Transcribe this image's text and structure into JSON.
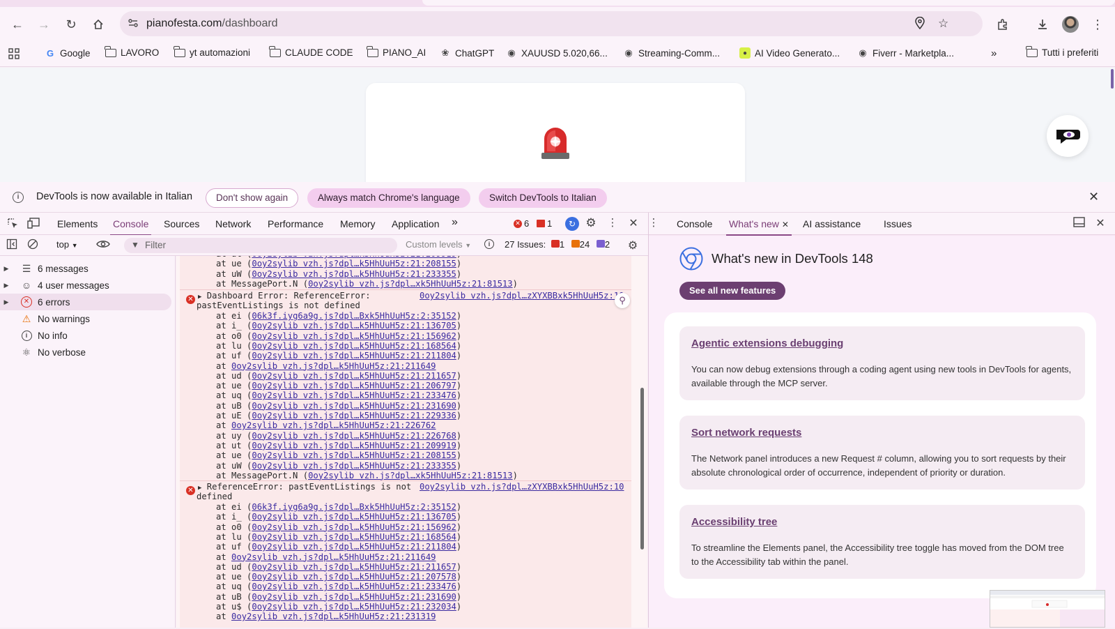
{
  "browser": {
    "url_host": "pianofesta.com",
    "url_path": "/dashboard",
    "icons": [
      "back-icon",
      "forward-icon",
      "reload-icon",
      "home-icon",
      "site-info-icon",
      "location-icon",
      "bookmark-star-icon",
      "extensions-icon",
      "download-icon",
      "profile-avatar",
      "menu-kebab-icon"
    ]
  },
  "bookmarks": [
    {
      "label": "Google",
      "icon": "google-icon"
    },
    {
      "label": "LAVORO",
      "icon": "folder-icon"
    },
    {
      "label": "yt automazioni",
      "icon": "folder-icon"
    },
    {
      "label": "CLAUDE CODE",
      "icon": "folder-icon"
    },
    {
      "label": "PIANO_AI",
      "icon": "folder-icon"
    },
    {
      "label": "ChatGPT",
      "icon": "chatgpt-icon"
    },
    {
      "label": "XAUUSD 5.020,66...",
      "icon": "globe-icon"
    },
    {
      "label": "Streaming-Comm...",
      "icon": "globe-icon"
    },
    {
      "label": "AI Video Generato...",
      "icon": "ai-video-icon"
    },
    {
      "label": "Fiverr - Marketpla...",
      "icon": "globe-icon"
    }
  ],
  "bookmarks_all": "Tutti i preferiti",
  "infobar": {
    "message": "DevTools is now available in Italian",
    "dont_show": "Don't show again",
    "always_match": "Always match Chrome's language",
    "switch": "Switch DevTools to Italian"
  },
  "devtools": {
    "tabs": [
      "Elements",
      "Console",
      "Sources",
      "Network",
      "Performance",
      "Memory",
      "Application"
    ],
    "active_tab": "Console",
    "error_count": "6",
    "warning_count": "1",
    "context": "top",
    "filter_placeholder": "Filter",
    "levels": "Custom levels",
    "issues_label": "27 Issues:",
    "issues_errors": "1",
    "issues_warnings": "24",
    "issues_info": "2"
  },
  "sidebar": [
    {
      "label": "6 messages",
      "icon": "list-icon",
      "expandable": true
    },
    {
      "label": "4 user messages",
      "icon": "user-icon",
      "expandable": true
    },
    {
      "label": "6 errors",
      "icon": "error-icon",
      "expandable": true,
      "selected": true
    },
    {
      "label": "No warnings",
      "icon": "warning-icon",
      "expandable": false
    },
    {
      "label": "No info",
      "icon": "info-icon",
      "expandable": false
    },
    {
      "label": "No verbose",
      "icon": "bug-icon",
      "expandable": false
    }
  ],
  "log": {
    "top_lines": [
      {
        "fn": "at ut (",
        "link": "0oy2sylib vzh.js?dpl…k5HhUuH5z:21:209919",
        "end": ")"
      },
      {
        "fn": "at ue (",
        "link": "0oy2sylib vzh.js?dpl…k5HhUuH5z:21:208155",
        "end": ")"
      },
      {
        "fn": "at uW (",
        "link": "0oy2sylib vzh.js?dpl…k5HhUuH5z:21:233355",
        "end": ")"
      },
      {
        "fn": "at MessagePort.N (",
        "link": "0oy2sylib vzh.js?dpl…xk5HhUuH5z:21:81513",
        "end": ")"
      }
    ],
    "error1": {
      "head1": "Dashboard Error: ReferenceError:",
      "head2": "pastEventListings is not defined",
      "source": "0oy2sylib vzh.js?dpl…zXYXBBxk5HhUuH5z:10",
      "lines": [
        {
          "fn": "at ei (",
          "link": "06k3f.iyg6a9g.js?dpl…Bxk5HhUuH5z:2:35152",
          "end": ")"
        },
        {
          "fn": "at i_ (",
          "link": "0oy2sylib vzh.js?dpl…k5HhUuH5z:21:136705",
          "end": ")"
        },
        {
          "fn": "at o0 (",
          "link": "0oy2sylib vzh.js?dpl…k5HhUuH5z:21:156962",
          "end": ")"
        },
        {
          "fn": "at lu (",
          "link": "0oy2sylib vzh.js?dpl…k5HhUuH5z:21:168564",
          "end": ")"
        },
        {
          "fn": "at uf (",
          "link": "0oy2sylib vzh.js?dpl…k5HhUuH5z:21:211804",
          "end": ")"
        },
        {
          "fn": "at ",
          "link": "0oy2sylib vzh.js?dpl…k5HhUuH5z:21:211649",
          "end": ""
        },
        {
          "fn": "at ud (",
          "link": "0oy2sylib vzh.js?dpl…k5HhUuH5z:21:211657",
          "end": ")"
        },
        {
          "fn": "at ue (",
          "link": "0oy2sylib vzh.js?dpl…k5HhUuH5z:21:206797",
          "end": ")"
        },
        {
          "fn": "at uq (",
          "link": "0oy2sylib vzh.js?dpl…k5HhUuH5z:21:233476",
          "end": ")"
        },
        {
          "fn": "at uB (",
          "link": "0oy2sylib vzh.js?dpl…k5HhUuH5z:21:231690",
          "end": ")"
        },
        {
          "fn": "at uE (",
          "link": "0oy2sylib vzh.js?dpl…k5HhUuH5z:21:229336",
          "end": ")"
        },
        {
          "fn": "at ",
          "link": "0oy2sylib vzh.js?dpl…k5HhUuH5z:21:226762",
          "end": ""
        },
        {
          "fn": "at uy (",
          "link": "0oy2sylib vzh.js?dpl…k5HhUuH5z:21:226768",
          "end": ")"
        },
        {
          "fn": "at ut (",
          "link": "0oy2sylib vzh.js?dpl…k5HhUuH5z:21:209919",
          "end": ")"
        },
        {
          "fn": "at ue (",
          "link": "0oy2sylib vzh.js?dpl…k5HhUuH5z:21:208155",
          "end": ")"
        },
        {
          "fn": "at uW (",
          "link": "0oy2sylib vzh.js?dpl…k5HhUuH5z:21:233355",
          "end": ")"
        },
        {
          "fn": "at MessagePort.N (",
          "link": "0oy2sylib vzh.js?dpl…xk5HhUuH5z:21:81513",
          "end": ")"
        }
      ]
    },
    "error2": {
      "head1": "ReferenceError: pastEventListings is not",
      "head2": "defined",
      "source": "0oy2sylib vzh.js?dpl…zXYXBBxk5HhUuH5z:10",
      "lines": [
        {
          "fn": "at ei (",
          "link": "06k3f.iyg6a9g.js?dpl…Bxk5HhUuH5z:2:35152",
          "end": ")"
        },
        {
          "fn": "at i_ (",
          "link": "0oy2sylib vzh.js?dpl…k5HhUuH5z:21:136705",
          "end": ")"
        },
        {
          "fn": "at o0 (",
          "link": "0oy2sylib vzh.js?dpl…k5HhUuH5z:21:156962",
          "end": ")"
        },
        {
          "fn": "at lu (",
          "link": "0oy2sylib vzh.js?dpl…k5HhUuH5z:21:168564",
          "end": ")"
        },
        {
          "fn": "at uf (",
          "link": "0oy2sylib vzh.js?dpl…k5HhUuH5z:21:211804",
          "end": ")"
        },
        {
          "fn": "at ",
          "link": "0oy2sylib vzh.js?dpl…k5HhUuH5z:21:211649",
          "end": ""
        },
        {
          "fn": "at ud (",
          "link": "0oy2sylib vzh.js?dpl…k5HhUuH5z:21:211657",
          "end": ")"
        },
        {
          "fn": "at ue (",
          "link": "0oy2sylib vzh.js?dpl…k5HhUuH5z:21:207578",
          "end": ")"
        },
        {
          "fn": "at uq (",
          "link": "0oy2sylib vzh.js?dpl…k5HhUuH5z:21:233476",
          "end": ")"
        },
        {
          "fn": "at uB (",
          "link": "0oy2sylib vzh.js?dpl…k5HhUuH5z:21:231690",
          "end": ")"
        },
        {
          "fn": "at u$ (",
          "link": "0oy2sylib vzh.js?dpl…k5HhUuH5z:21:232034",
          "end": ")"
        },
        {
          "fn": "at ",
          "link": "0oy2sylib vzh.js?dpl…k5HhUuH5z:21:231319",
          "end": ""
        }
      ]
    }
  },
  "drawer": {
    "tabs": [
      "Console",
      "What's new",
      "AI assistance",
      "Issues"
    ],
    "active_tab": "What's new",
    "title": "What's new in DevTools 148",
    "see_all": "See all new features",
    "features": [
      {
        "title": "Agentic extensions debugging",
        "body": "You can now debug extensions through a coding agent using new tools in DevTools for agents, available through the MCP server."
      },
      {
        "title": "Sort network requests",
        "body": "The Network panel introduces a new Request # column, allowing you to sort requests by their absolute chronological order of occurrence, independent of priority or duration."
      },
      {
        "title": "Accessibility tree",
        "body": "To streamline the Elements panel, the Accessibility tree toggle has moved from the DOM tree to the Accessibility tab within the panel."
      }
    ]
  },
  "colors": {
    "accent": "#8a4886",
    "error": "#d93025",
    "link": "#3a2aa0",
    "button": "#6c3f71"
  }
}
